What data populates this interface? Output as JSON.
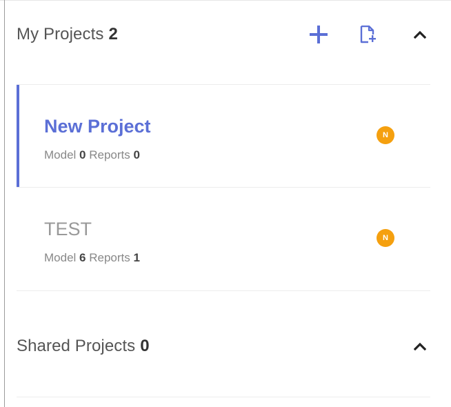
{
  "my_projects": {
    "title": "My Projects",
    "count": "2",
    "add_icon": "plus-icon",
    "new_file_icon": "new-document-icon",
    "collapse_icon": "chevron-up-icon"
  },
  "projects": [
    {
      "name": "New Project",
      "model_label": "Model",
      "model_count": "0",
      "reports_label": "Reports",
      "reports_count": "0",
      "badge": "N",
      "active": true
    },
    {
      "name": "TEST",
      "model_label": "Model",
      "model_count": "6",
      "reports_label": "Reports",
      "reports_count": "1",
      "badge": "N",
      "active": false
    }
  ],
  "shared_projects": {
    "title": "Shared Projects",
    "count": "0",
    "collapse_icon": "chevron-up-icon"
  },
  "colors": {
    "accent": "#5b6fd6",
    "badge": "#f5a00f",
    "muted_text": "#999999"
  }
}
